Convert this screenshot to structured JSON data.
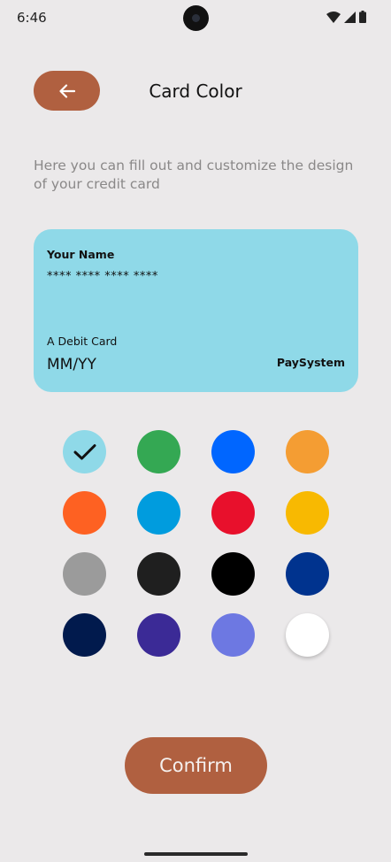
{
  "status_bar": {
    "time": "6:46",
    "icons": [
      "wifi-icon",
      "cellular-signal-icon",
      "battery-icon"
    ]
  },
  "header": {
    "back_icon": "arrow-left-icon",
    "title": "Card Color"
  },
  "description": "Here you can fill out and customize the design of your credit card",
  "card_preview": {
    "name_label": "Your Name",
    "number": "**** **** **** ****",
    "type_label": "A Debit Card",
    "expiry": "MM/YY",
    "brand": "PaySystem",
    "background_color": "#8fd9e8"
  },
  "colors": {
    "selected_index": 0,
    "options": [
      "#8fd9e8",
      "#34a853",
      "#0066ff",
      "#f49d33",
      "#fe6122",
      "#009cde",
      "#e8102c",
      "#f8b901",
      "#9b9b9b",
      "#1f1f1f",
      "#000000",
      "#00338e",
      "#011a4d",
      "#3b2a96",
      "#6d78e2",
      "#ffffff"
    ]
  },
  "accent_color": "#b06040",
  "confirm_label": "Confirm"
}
